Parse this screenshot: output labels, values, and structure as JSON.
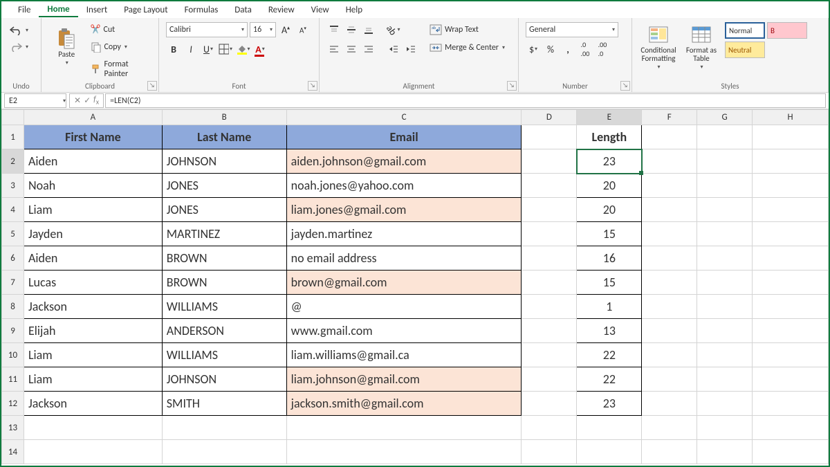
{
  "menu": {
    "items": [
      "File",
      "Home",
      "Insert",
      "Page Layout",
      "Formulas",
      "Data",
      "Review",
      "View",
      "Help"
    ],
    "activeIndex": 1
  },
  "ribbon": {
    "undo": {
      "label": "Undo"
    },
    "clipboard": {
      "label": "Clipboard",
      "paste": "Paste",
      "cut": "Cut",
      "copy": "Copy",
      "formatPainter": "Format Painter"
    },
    "font": {
      "label": "Font",
      "name": "Calibri",
      "size": "16"
    },
    "alignment": {
      "label": "Alignment",
      "wrap": "Wrap Text",
      "merge": "Merge & Center"
    },
    "number": {
      "label": "Number",
      "format": "General"
    },
    "styles": {
      "label": "Styles",
      "conditional": "Conditional Formatting",
      "formatAs": "Format as Table",
      "normal": "Normal",
      "bad": "B",
      "neutral": "Neutral"
    }
  },
  "formulaBar": {
    "nameBox": "E2",
    "formula": "=LEN(C2)"
  },
  "colHeaders": [
    "A",
    "B",
    "C",
    "D",
    "E",
    "F",
    "G",
    "H"
  ],
  "headers": {
    "A": "First Name",
    "B": "Last Name",
    "C": "Email",
    "E": "Length"
  },
  "rows": [
    {
      "first": "Aiden",
      "last": "JOHNSON",
      "email": "aiden.johnson@gmail.com",
      "hl": true,
      "len": "23"
    },
    {
      "first": "Noah",
      "last": "JONES",
      "email": "noah.jones@yahoo.com",
      "hl": false,
      "len": "20"
    },
    {
      "first": "Liam",
      "last": "JONES",
      "email": "liam.jones@gmail.com",
      "hl": true,
      "len": "20"
    },
    {
      "first": "Jayden",
      "last": "MARTINEZ",
      "email": "jayden.martinez",
      "hl": false,
      "len": "15"
    },
    {
      "first": "Aiden",
      "last": "BROWN",
      "email": "no email address",
      "hl": false,
      "len": "16"
    },
    {
      "first": "Lucas",
      "last": "BROWN",
      "email": "brown@gmail.com",
      "hl": true,
      "len": "15"
    },
    {
      "first": "Jackson",
      "last": "WILLIAMS",
      "email": "@",
      "hl": false,
      "len": "1"
    },
    {
      "first": "Elijah",
      "last": "ANDERSON",
      "email": "www.gmail.com",
      "hl": false,
      "len": "13"
    },
    {
      "first": "Liam",
      "last": "WILLIAMS",
      "email": "liam.williams@gmail.ca",
      "hl": false,
      "len": "22"
    },
    {
      "first": "Liam",
      "last": "JOHNSON",
      "email": "liam.johnson@gmail.com",
      "hl": true,
      "len": "22"
    },
    {
      "first": "Jackson",
      "last": "SMITH",
      "email": "jackson.smith@gmail.com",
      "hl": true,
      "len": "23"
    }
  ]
}
